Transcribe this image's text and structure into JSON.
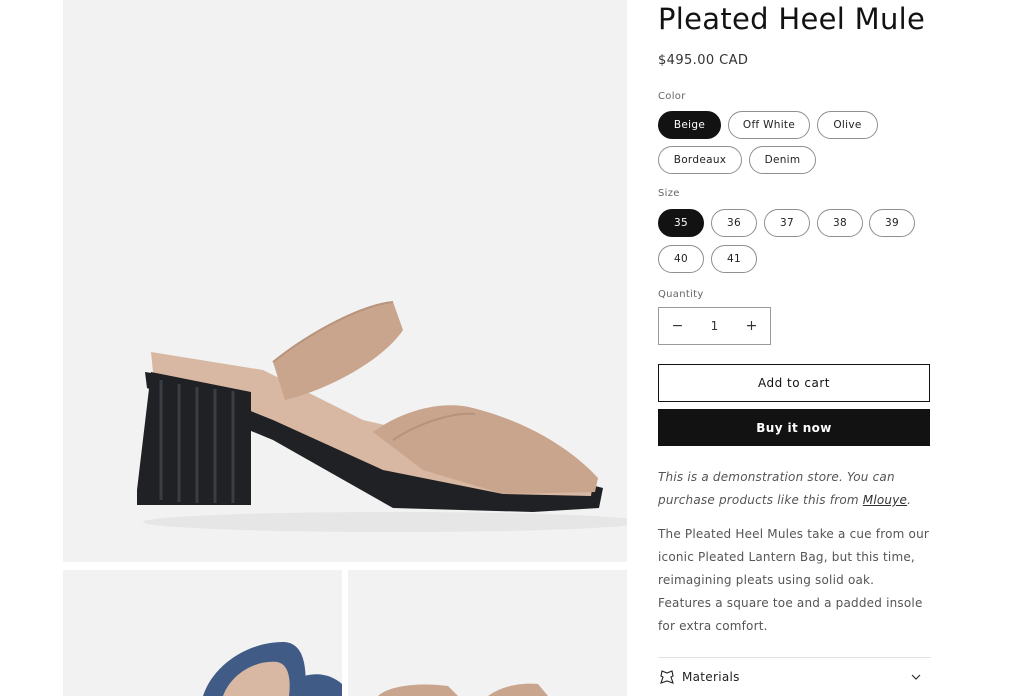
{
  "product": {
    "title": "Pleated Heel Mule",
    "price": "$495.00 CAD"
  },
  "color": {
    "label": "Color",
    "options": [
      "Beige",
      "Off White",
      "Olive",
      "Bordeaux",
      "Denim"
    ],
    "selected": "Beige"
  },
  "size": {
    "label": "Size",
    "options": [
      "35",
      "36",
      "37",
      "38",
      "39",
      "40",
      "41"
    ],
    "selected": "35"
  },
  "quantity": {
    "label": "Quantity",
    "value": "1",
    "decrease_symbol": "−",
    "increase_symbol": "+"
  },
  "actions": {
    "add_to_cart": "Add to cart",
    "buy_now": "Buy it now"
  },
  "notice": {
    "text_before": "This is a demonstration store. You can purchase products like this from ",
    "link": "Mlouye",
    "text_after": "."
  },
  "description": "The Pleated Heel Mules take a cue from our iconic Pleated Lantern Bag, but this time, reimagining pleats using solid oak. Features a square toe and a padded insole for extra comfort.",
  "accordion": {
    "materials_label": "Materials",
    "icon": "fabric-icon",
    "chevron": "chevron-down-icon"
  },
  "colors": {
    "background": "#ffffff",
    "image_bg": "#f2f2f2",
    "text": "#121212",
    "accent": "#121212",
    "suede": "#c9a58e",
    "heel": "#1f2124",
    "denim": "#3f5b86"
  }
}
